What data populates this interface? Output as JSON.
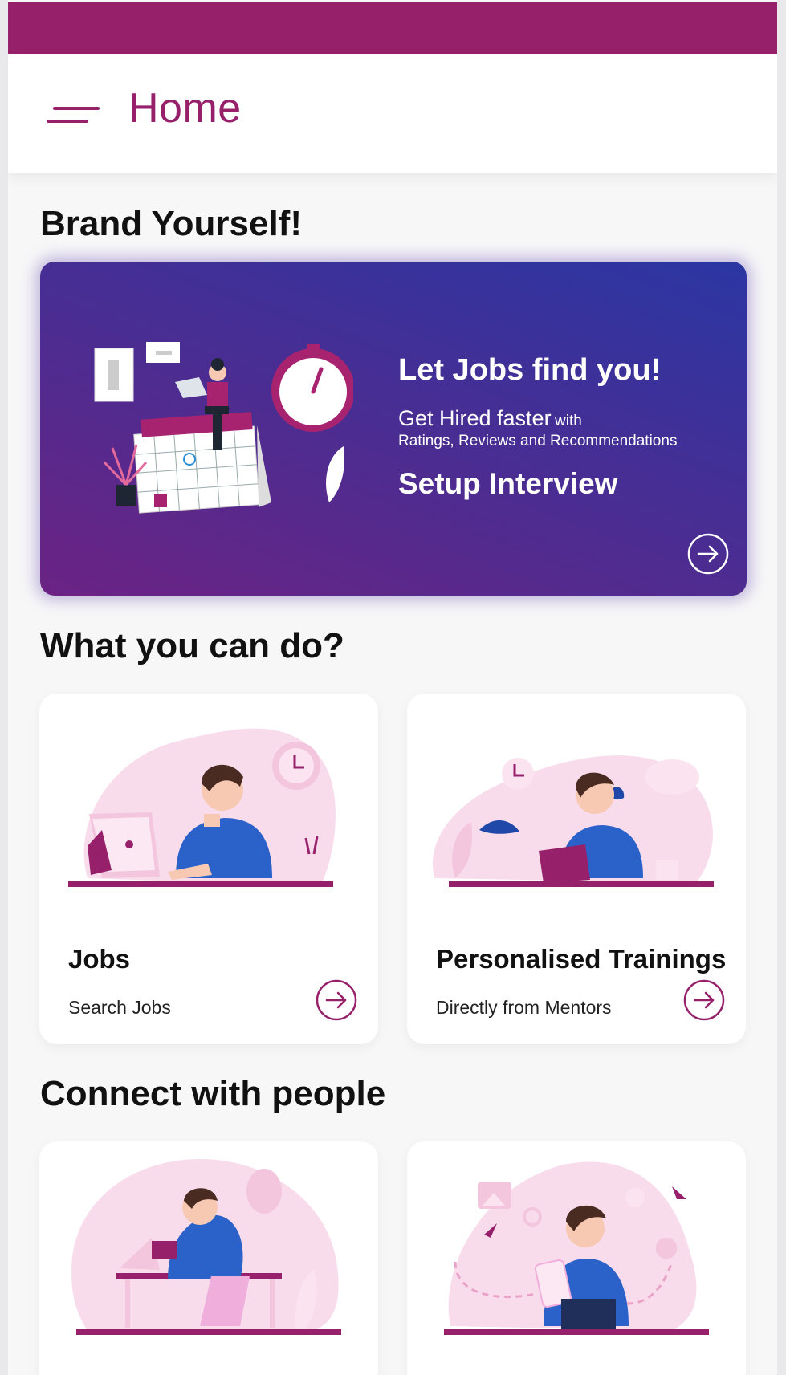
{
  "header": {
    "title": "Home",
    "menu_icon": "hamburger-menu-icon"
  },
  "colors": {
    "brand": "#97206b",
    "promo_gradient_start": "#2b36a3",
    "promo_gradient_end": "#6b2384",
    "illustration_pink": "#f7d6ea",
    "illustration_blue": "#2a62c9"
  },
  "sections": {
    "brand": "Brand Yourself!",
    "actions": "What you can do?",
    "connect": "Connect with people"
  },
  "promo": {
    "headline": "Let Jobs find you!",
    "sub_big": "Get Hired faster",
    "sub_small": "with",
    "sub_line2": "Ratings, Reviews and Recommendations",
    "cta": "Setup Interview",
    "arrow_icon": "arrow-right-circle-icon"
  },
  "action_cards": [
    {
      "title": "Jobs",
      "subtitle": "Search Jobs",
      "icon": "arrow-right-circle-icon"
    },
    {
      "title": "Personalised Trainings",
      "subtitle": "Directly from Mentors",
      "icon": "arrow-right-circle-icon"
    }
  ]
}
